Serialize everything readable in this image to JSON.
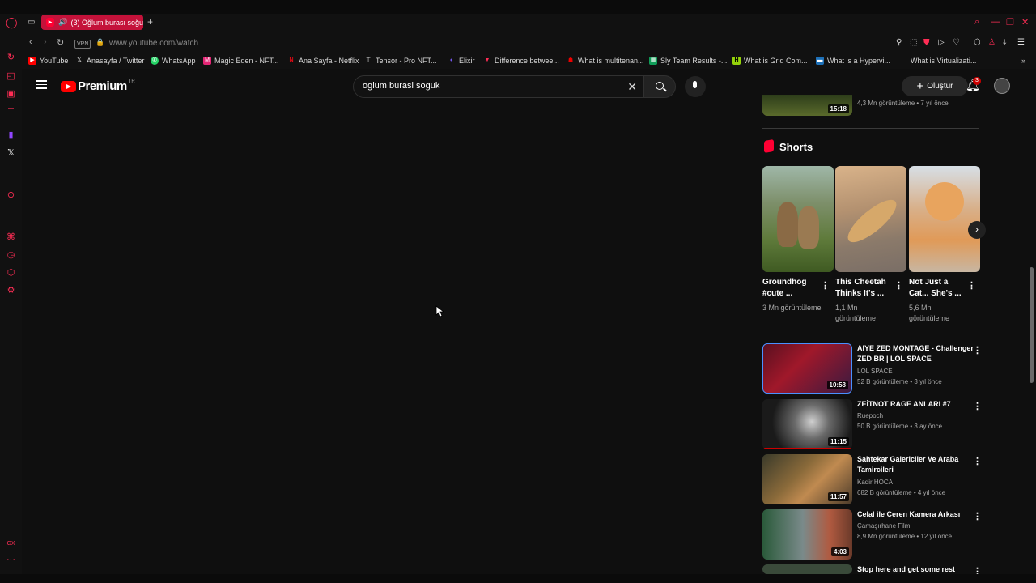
{
  "browser": {
    "tab": {
      "label": "(3) Oğlum burası soğu",
      "new_tab_label": "+"
    },
    "address": {
      "vpn_label": "VPN",
      "url": "www.youtube.com/watch"
    },
    "bookmarks": [
      {
        "label": "YouTube",
        "icon": "youtube-icon",
        "color": "#ff0000"
      },
      {
        "label": "Anasayfa / Twitter",
        "icon": "x-icon",
        "color": "#ffffff"
      },
      {
        "label": "WhatsApp",
        "icon": "whatsapp-icon",
        "color": "#25d366"
      },
      {
        "label": "Magic Eden - NFT...",
        "icon": "magic-eden-icon",
        "color": "#e42575"
      },
      {
        "label": "Ana Sayfa - Netflix",
        "icon": "netflix-icon",
        "color": "#e50914"
      },
      {
        "label": "Tensor - Pro NFT...",
        "icon": "tensor-icon",
        "color": "#ffffff"
      },
      {
        "label": "Elixir",
        "icon": "elixir-icon",
        "color": "#7b5cff"
      },
      {
        "label": "Difference betwee...",
        "icon": "difference-icon",
        "color": "#ff2d55"
      },
      {
        "label": "What is multitenan...",
        "icon": "redhat-icon",
        "color": "#ee0000"
      },
      {
        "label": "Sly Team Results -...",
        "icon": "sheets-icon",
        "color": "#0f9d58"
      },
      {
        "label": "What is Grid Com...",
        "icon": "h-icon",
        "color": "#94d30a"
      },
      {
        "label": "What is a Hypervi...",
        "icon": "vmware-icon",
        "color": "#1d70b8"
      },
      {
        "label": "What is Virtualizati...",
        "icon": "page-icon",
        "color": "#888888"
      }
    ]
  },
  "youtube": {
    "logo_text": "Premium",
    "region": "TR",
    "search": {
      "value": "oglum burasi soguk"
    },
    "create_label": "Oluştur",
    "notification_count": "3",
    "prev_video_meta": "4,3 Mn görüntüleme • 7 yıl önce",
    "prev_video_duration": "15:18",
    "shorts": {
      "heading": "Shorts",
      "items": [
        {
          "title": "Groundhog #cute ...",
          "views": "3 Mn görüntüleme"
        },
        {
          "title": "This Cheetah Thinks It's ...",
          "views": "1,1 Mn görüntüleme"
        },
        {
          "title": "Not Just a Cat... She's ...",
          "views": "5,6 Mn görüntüleme"
        }
      ]
    },
    "videos": [
      {
        "title": "AIYE ZED MONTAGE - Challenger ZED BR | LOL SPACE",
        "channel": "LOL SPACE",
        "meta": "52 B görüntüleme • 3 yıl önce",
        "duration": "10:58"
      },
      {
        "title": "ZEİTNOT RAGE ANLARI #7",
        "channel": "Ruepoch",
        "meta": "50 B görüntüleme • 3 ay önce",
        "duration": "11:15"
      },
      {
        "title": "Sahtekar Galericiler Ve Araba Tamircileri",
        "channel": "Kadir HOCA",
        "meta": "682 B görüntüleme • 4 yıl önce",
        "duration": "11:57"
      },
      {
        "title": "Celal ile Ceren Kamera Arkası",
        "channel": "Çamaşırhane Film",
        "meta": "8,9 Mn görüntüleme • 12 yıl önce",
        "duration": "4:03"
      },
      {
        "title": "Stop here and get some rest"
      }
    ]
  }
}
